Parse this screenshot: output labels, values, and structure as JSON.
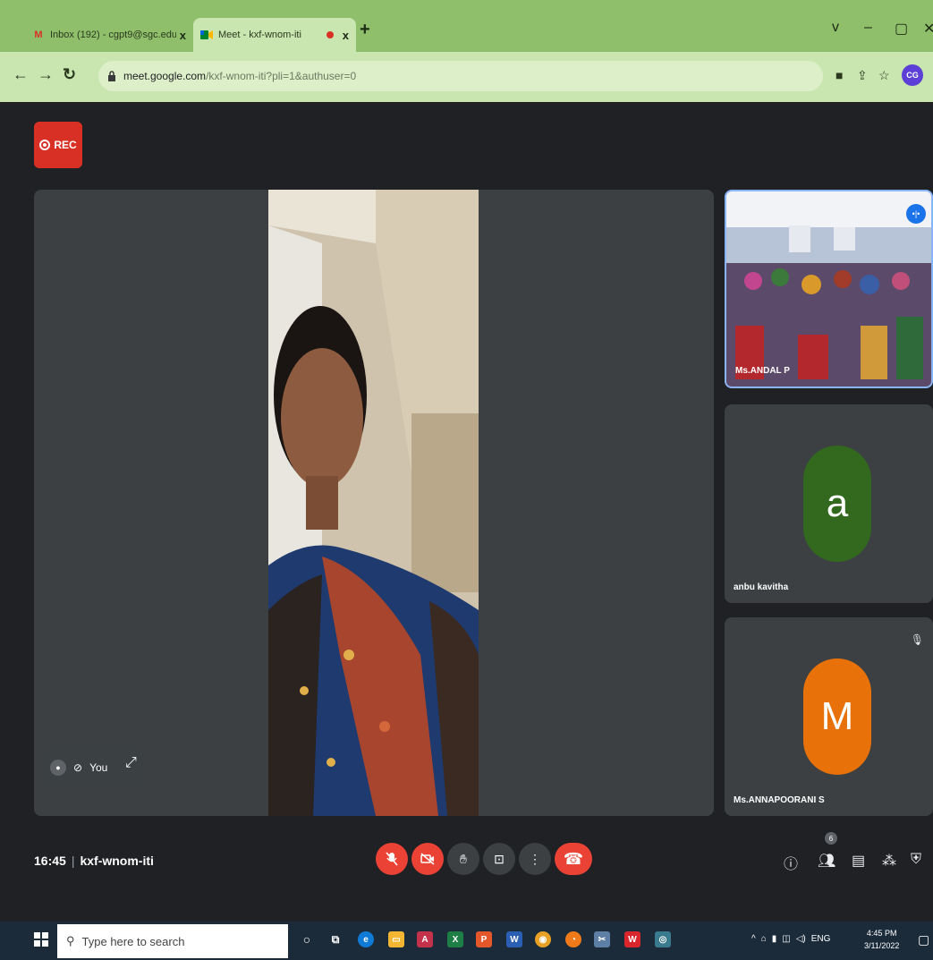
{
  "browser": {
    "tabs": [
      {
        "title": "Inbox (192) - cgpt9@sgc.edu - ",
        "close": "x",
        "favicon": "gmail-icon"
      },
      {
        "title": "Meet - kxf-wnom-iti",
        "close": "x",
        "favicon": "meet-icon",
        "recording": true
      }
    ],
    "new_tab": "+",
    "window_controls": {
      "dropdown": "v",
      "minimize": "–",
      "restore": "▢",
      "close": "✕"
    },
    "url_host": "meet.google.com",
    "url_path": "/kxf-wnom-iti?pli=1&authuser=0",
    "profile_initials": "CG"
  },
  "meet": {
    "rec_label": "REC",
    "self_label": "You",
    "participants": [
      {
        "name": "Ms.ANDAL P",
        "type": "video"
      },
      {
        "name": "anbu kavitha",
        "initial": "a",
        "color": "#33691e"
      },
      {
        "name": "Ms.ANNAPOORANI S",
        "initial": "M",
        "color": "#e8710a"
      }
    ],
    "time": "16:45",
    "meeting_code": "kxf-wnom-iti",
    "people_count": "6"
  },
  "taskbar": {
    "search_placeholder": "Type here to search",
    "lang": "ENG",
    "time": "4:45 PM",
    "date": "3/11/2022"
  },
  "colors": {
    "chrome_frame": "#8fbf6a",
    "chrome_toolbar": "#c9e5b0",
    "meet_bg": "#202124",
    "tile_bg": "#3c4043",
    "red": "#ea4335",
    "taskbar": "#1b2b3a"
  }
}
